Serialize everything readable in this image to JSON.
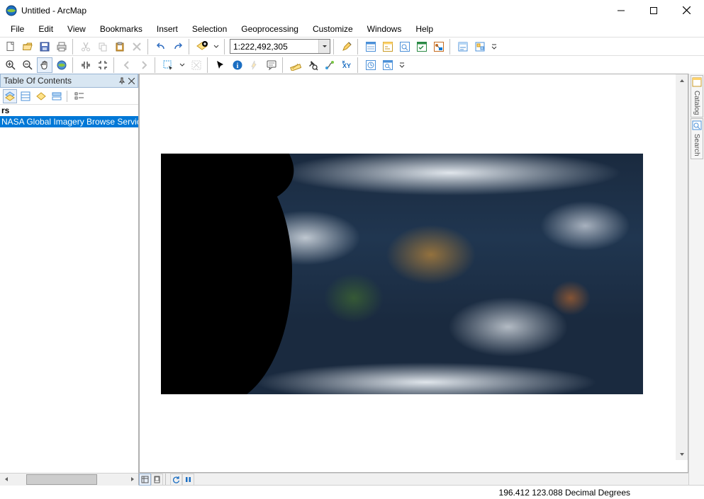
{
  "window": {
    "title": "Untitled - ArcMap"
  },
  "menubar": [
    "File",
    "Edit",
    "View",
    "Bookmarks",
    "Insert",
    "Selection",
    "Geoprocessing",
    "Customize",
    "Windows",
    "Help"
  ],
  "toolbar1": {
    "scale_value": "1:222,492,305"
  },
  "toc": {
    "title": "Table Of Contents",
    "root_label": "rs",
    "selected_layer": "NASA Global Imagery Browse Service"
  },
  "rightbar": {
    "tab1": "Catalog",
    "tab2": "Search"
  },
  "view_modes": {
    "data": "▦",
    "layout": "▣",
    "refresh": "↻",
    "pause": "❚❚"
  },
  "status": {
    "coords": "196.412 123.088 Decimal Degrees"
  }
}
